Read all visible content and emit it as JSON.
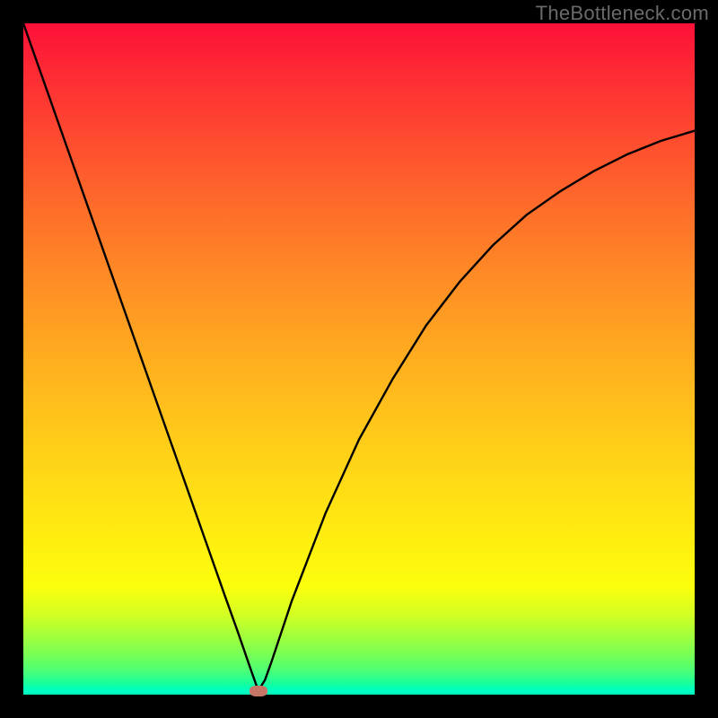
{
  "watermark": "TheBottleneck.com",
  "chart_data": {
    "type": "line",
    "title": "",
    "xlabel": "",
    "ylabel": "",
    "xlim": [
      0,
      100
    ],
    "ylim": [
      0,
      100
    ],
    "grid": false,
    "legend": false,
    "series": [
      {
        "name": "curve",
        "x": [
          0,
          5,
          10,
          15,
          20,
          25,
          30,
          32,
          34,
          35,
          36,
          37,
          40,
          45,
          50,
          55,
          60,
          65,
          70,
          75,
          80,
          85,
          90,
          95,
          100
        ],
        "y": [
          100,
          85.8,
          71.6,
          57.4,
          43.2,
          29.0,
          14.8,
          9.2,
          3.4,
          0.6,
          2.2,
          5.0,
          14.0,
          27.0,
          38.0,
          47.0,
          55.0,
          61.5,
          67.0,
          71.5,
          75.0,
          78.0,
          80.5,
          82.5,
          84.0
        ]
      }
    ],
    "marker": {
      "x": 35,
      "y": 0.5
    },
    "background_gradient": {
      "top": "#fd1038",
      "bottom": "#00e9b4"
    }
  }
}
